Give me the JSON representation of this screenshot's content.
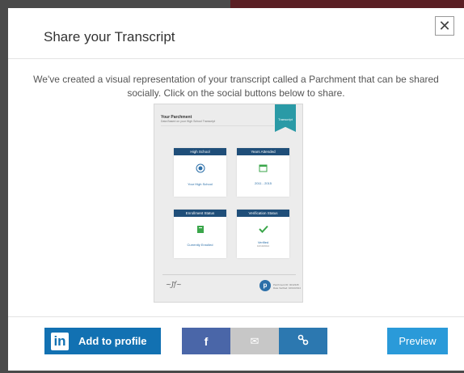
{
  "modal": {
    "title": "Share your Transcript",
    "close_glyph": "✕",
    "description": "We've created a visual representation of your transcript called a Parchment that can be shared socially. Click on the social buttons below to share."
  },
  "parchment": {
    "title": "Your Parchment",
    "subtitle": "Data Based on your High School Transcript",
    "ribbon": "Transcript",
    "tiles": [
      {
        "heading": "High School",
        "icon": "school-seal-icon",
        "value": "Your High School",
        "sub": ""
      },
      {
        "heading": "Years Attended",
        "icon": "calendar-icon",
        "value": "2011 - 2015",
        "sub": ""
      },
      {
        "heading": "Enrollment Status",
        "icon": "book-icon",
        "value": "Currently Enrolled",
        "sub": ""
      },
      {
        "heading": "Verification Status",
        "icon": "checkmark-icon",
        "value": "Verified",
        "sub": "10/10/2014"
      }
    ],
    "logo_letter": "p",
    "logo_text_1": "Parchment ID: 0012345",
    "logo_text_2": "Date Verified: 10/10/2014"
  },
  "footer": {
    "linkedin_logo": "in",
    "linkedin_label": "Add to profile",
    "facebook_glyph": "f",
    "email_glyph": "✉",
    "link_glyph": "%",
    "preview_label": "Preview"
  },
  "colors": {
    "linkedin": "#1271b2",
    "facebook": "#4a66a8",
    "email": "#c7c7c7",
    "link": "#2c78b0",
    "preview": "#2a9ad9",
    "tile_header": "#1f4e79",
    "ribbon": "#2a9aa6"
  }
}
